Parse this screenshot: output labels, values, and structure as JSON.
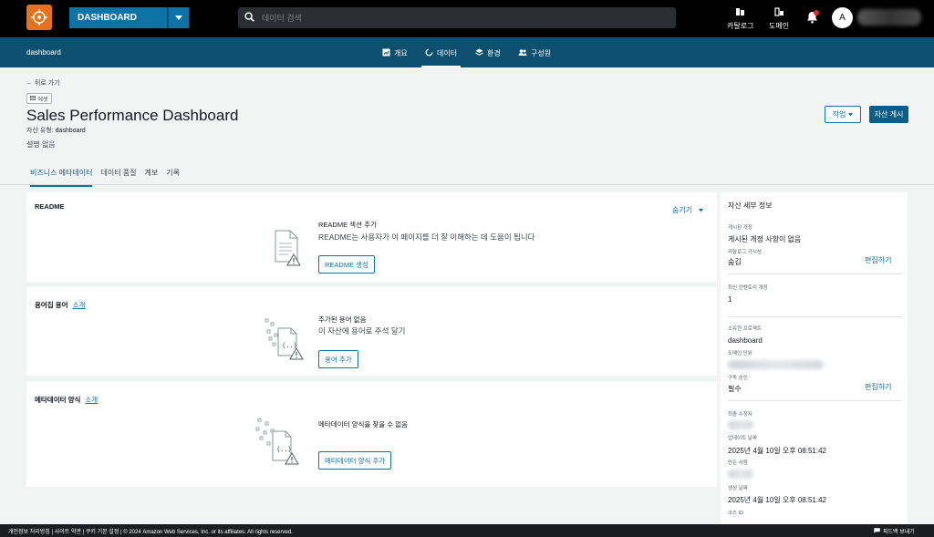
{
  "topbar": {
    "domain_name": "DASHBOARD",
    "search_placeholder": "데이터 검색",
    "catalog_label": "카탈로그",
    "domain_label": "도메인",
    "avatar_letter": "A"
  },
  "navbar": {
    "project_name": "dashboard",
    "tabs": [
      {
        "label": "개요"
      },
      {
        "label": "데이터"
      },
      {
        "label": "환경"
      },
      {
        "label": "구성원"
      }
    ]
  },
  "header": {
    "back_label": "뒤로 가기",
    "asset_chip": "에셋",
    "title": "Sales Performance Dashboard",
    "asset_type_label": "자산 유형:",
    "asset_type_value": "dashboard",
    "description": "설명 없음",
    "action_button": "작업",
    "publish_button": "자산 게시"
  },
  "subtabs": [
    {
      "label": "비즈니스 메타데이터"
    },
    {
      "label": "데이터 품질"
    },
    {
      "label": "계보"
    },
    {
      "label": "기록"
    }
  ],
  "readme": {
    "title": "README",
    "hide_label": "숨기기",
    "heading": "README 섹션 추가",
    "text": "README는 사용자가 이 페이지를 더 잘 이해하는 데 도움이 됩니다",
    "button": "README 생성"
  },
  "glossary": {
    "title": "용어집 용어",
    "intro": "소개",
    "heading": "추가된 용어 없음",
    "text": "이 자산에 용어로 주석 달기",
    "button": "용어 추가"
  },
  "metadata_forms": {
    "title": "메타데이터 양식",
    "intro": "소개",
    "heading": "메타데이터 양식을 찾을 수 없음",
    "button": "메타데이터 양식 추가"
  },
  "side_panel": {
    "title": "자산 세부 정보",
    "published_revision_label": "게시된 개정",
    "published_revision_value": "게시된 개정 사항이 없음",
    "catalog_visibility_label": "카탈로그 가시성",
    "catalog_visibility_value": "숨김",
    "edit_label": "편집하기",
    "latest_inventory_label": "최신 인벤토리 개정",
    "latest_inventory_value": "1",
    "owning_project_label": "소유한 프로젝트",
    "owning_project_value": "dashboard",
    "domain_unit_label": "도메인 단위",
    "subscription_label": "구독 승인",
    "subscription_value": "필수",
    "last_modifier_label": "최종 수정자",
    "updated_date_label": "업데이트 날짜",
    "updated_date_value": "2025년 4월 10일 오후 08:51:42",
    "creator_label": "만든 사람",
    "created_date_label": "생성 날짜",
    "created_date_value": "2025년 4월 10일 오후 08:51:42",
    "source_id_label": "소스 ID"
  },
  "footer": {
    "text": "개인정보 처리방침 | 사이트 약관 | 쿠키 기본 설정 | © 2024 Amazon Web Services, Inc. or its affiliates. All rights reserved.",
    "feedback": "피드백 보내기"
  },
  "colors": {
    "accent": "#0b73a6",
    "nav_bg": "#0d4f6e",
    "logo": "#e8721c"
  }
}
